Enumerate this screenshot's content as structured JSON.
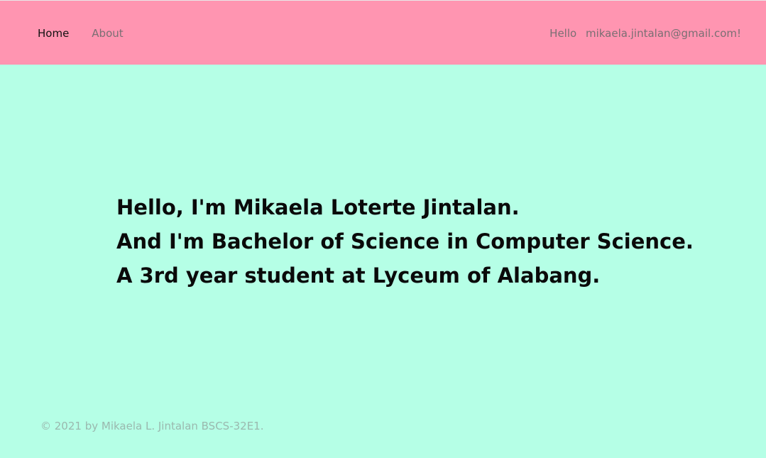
{
  "nav": {
    "links": [
      {
        "label": "Home"
      },
      {
        "label": "About"
      }
    ],
    "greeting": "Hello",
    "user_email": "mikaela.jintalan@gmail.com!"
  },
  "hero": {
    "lines": [
      "Hello, I'm Mikaela Loterte Jintalan.",
      "And I'm Bachelor of Science in Computer Science.",
      "A 3rd year student at Lyceum of Alabang."
    ]
  },
  "footer": {
    "text": "© 2021 by Mikaela L. Jintalan BSCS-32E1."
  },
  "colors": {
    "navbar_bg": "#ff95b1",
    "page_bg": "#b5ffe6",
    "active_link": "#111111",
    "muted_text": "#7a6f73",
    "footer_text": "#9ab8ae"
  }
}
